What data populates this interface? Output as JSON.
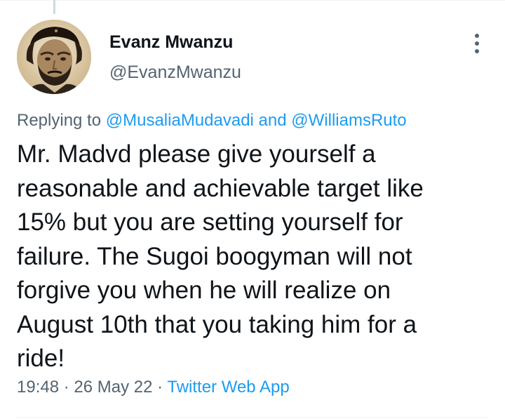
{
  "author": {
    "display_name": "Evanz Mwanzu",
    "handle": "@EvanzMwanzu",
    "avatar_icon": "profile-photo"
  },
  "reply": {
    "prefix": "Replying to",
    "user1": "@MusaliaMudavadi",
    "conjunction": "and",
    "user2": "@WilliamsRuto"
  },
  "tweet": {
    "lines": [
      "Mr. Madvd please give yourself a",
      "reasonable and achievable target like",
      "15% but you are setting yourself for",
      "failure. The Sugoi boogyman will not",
      "forgive you when he will realize on",
      "August 10th that you taking him for a",
      "ride!"
    ]
  },
  "meta": {
    "time": "19:48",
    "separator": "·",
    "date": "26 May 22",
    "source": "Twitter Web App"
  },
  "icons": {
    "more": "more-options-icon"
  },
  "colors": {
    "text": "#0f1419",
    "secondary": "#536471",
    "link": "#1d9bf0"
  }
}
